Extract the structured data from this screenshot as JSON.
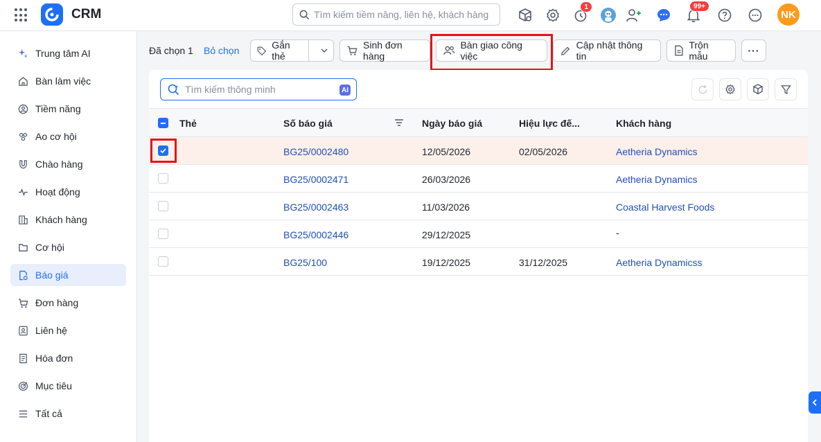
{
  "app": {
    "title": "CRM"
  },
  "topbar": {
    "search_placeholder": "Tìm kiếm tiềm năng, liên hệ, khách hàng",
    "timer_badge": "1",
    "notification_badge": "99+",
    "user_initials": "NK"
  },
  "sidebar": {
    "items": [
      {
        "label": "Trung tâm AI",
        "icon": "sparkle-icon"
      },
      {
        "label": "Bàn làm việc",
        "icon": "home-icon"
      },
      {
        "label": "Tiềm năng",
        "icon": "target-person-icon"
      },
      {
        "label": "Ao cơ hội",
        "icon": "people-group-icon"
      },
      {
        "label": "Chào hàng",
        "icon": "magnet-icon"
      },
      {
        "label": "Hoạt động",
        "icon": "pulse-icon"
      },
      {
        "label": "Khách hàng",
        "icon": "building-icon"
      },
      {
        "label": "Cơ hội",
        "icon": "folder-icon"
      },
      {
        "label": "Báo giá",
        "icon": "quote-doc-icon",
        "active": true
      },
      {
        "label": "Đơn hàng",
        "icon": "cart-icon"
      },
      {
        "label": "Liên hệ",
        "icon": "contact-card-icon"
      },
      {
        "label": "Hóa đơn",
        "icon": "invoice-icon"
      },
      {
        "label": "Mục tiêu",
        "icon": "goal-icon"
      },
      {
        "label": "Tất cả",
        "icon": "menu-icon"
      }
    ]
  },
  "actionbar": {
    "selected_text": "Đã chọn 1",
    "unselect": "Bỏ chọn",
    "tag": "Gắn thẻ",
    "create_order": "Sinh đơn hàng",
    "handover": "Bàn giao công việc",
    "update_info": "Cập nhật thông tin",
    "merge_template": "Trộn mẫu",
    "more": "···"
  },
  "table": {
    "search_placeholder": "Tìm kiếm thông minh",
    "ai_label": "AI",
    "columns": [
      "Thẻ",
      "Số báo giá",
      "Ngày báo giá",
      "Hiệu lực đế...",
      "Khách hàng"
    ],
    "rows": [
      {
        "tag": "",
        "number": "BG25/0002480",
        "date": "12/05/2026",
        "valid_until": "02/05/2026",
        "customer": "Aetheria Dynamics",
        "checked": true
      },
      {
        "tag": "",
        "number": "BG25/0002471",
        "date": "26/03/2026",
        "valid_until": "",
        "customer": "Aetheria Dynamics",
        "checked": false
      },
      {
        "tag": "",
        "number": "BG25/0002463",
        "date": "11/03/2026",
        "valid_until": "",
        "customer": "Coastal Harvest Foods",
        "checked": false
      },
      {
        "tag": "",
        "number": "BG25/0002446",
        "date": "29/12/2025",
        "valid_until": "",
        "customer": "-",
        "checked": false
      },
      {
        "tag": "",
        "number": "BG25/100",
        "date": "19/12/2025",
        "valid_until": "31/12/2025",
        "customer": "Aetheria Dynamicss",
        "checked": false
      }
    ]
  },
  "colors": {
    "accent": "#1e6ff5",
    "highlight": "#e3141a",
    "selected_row": "#fdf0eb"
  }
}
